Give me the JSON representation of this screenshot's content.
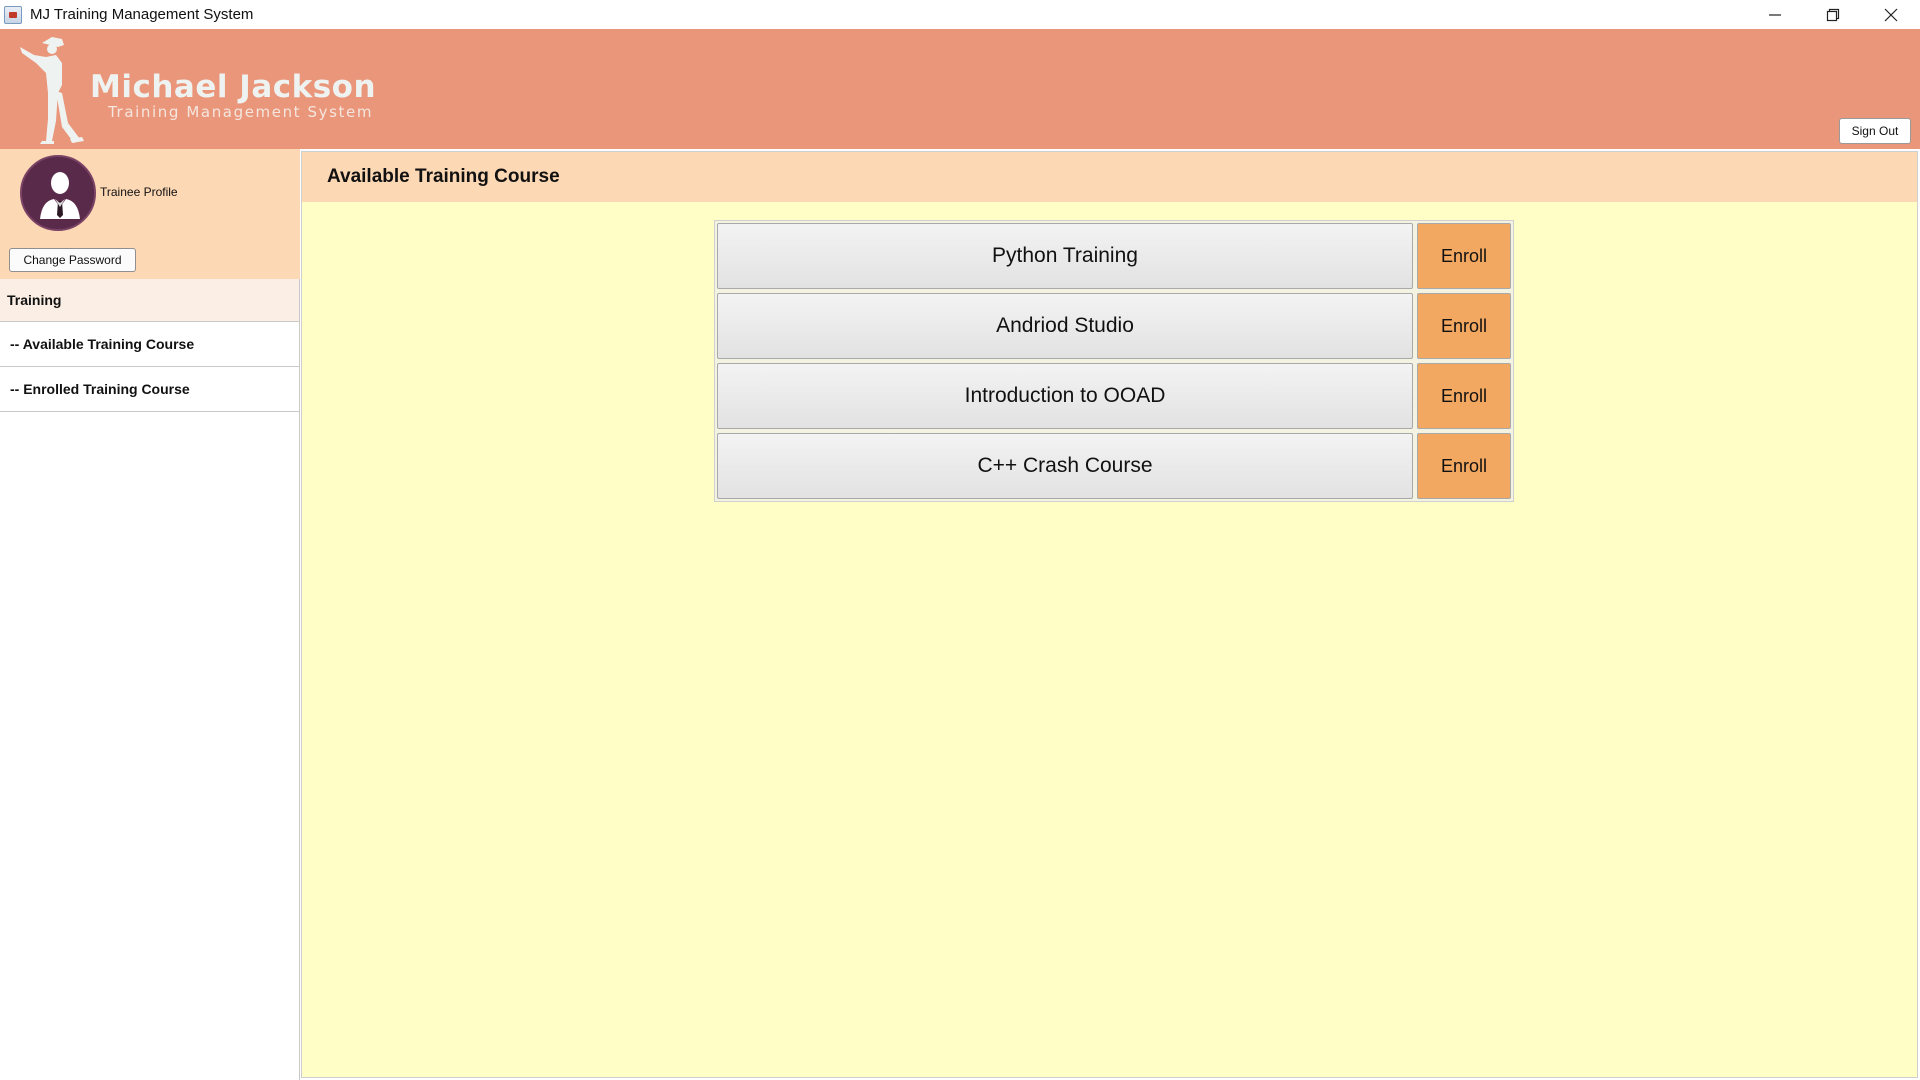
{
  "window": {
    "title": "MJ Training Management System",
    "app_icon": "java-cup-icon",
    "controls": [
      "minimize-icon",
      "restore-icon",
      "close-icon"
    ]
  },
  "header": {
    "brand_title": "Michael Jackson",
    "brand_subtitle": "Training Management System",
    "sign_out_label": "Sign Out",
    "background_color": "#ea967a"
  },
  "sidebar": {
    "profile_label": "Trainee Profile",
    "change_password_label": "Change Password",
    "section_header": "Training",
    "items": [
      {
        "label": "-- Available Training Course"
      },
      {
        "label": "-- Enrolled Training Course"
      }
    ]
  },
  "main": {
    "title": "Available Training Course",
    "background_color": "#fffec6",
    "courses": [
      {
        "name": "Python Training",
        "action": "Enroll"
      },
      {
        "name": "Andriod Studio",
        "action": "Enroll"
      },
      {
        "name": "Introduction to OOAD",
        "action": "Enroll"
      },
      {
        "name": "C++ Crash Course",
        "action": "Enroll"
      }
    ],
    "enroll_color": "#f3a862"
  }
}
